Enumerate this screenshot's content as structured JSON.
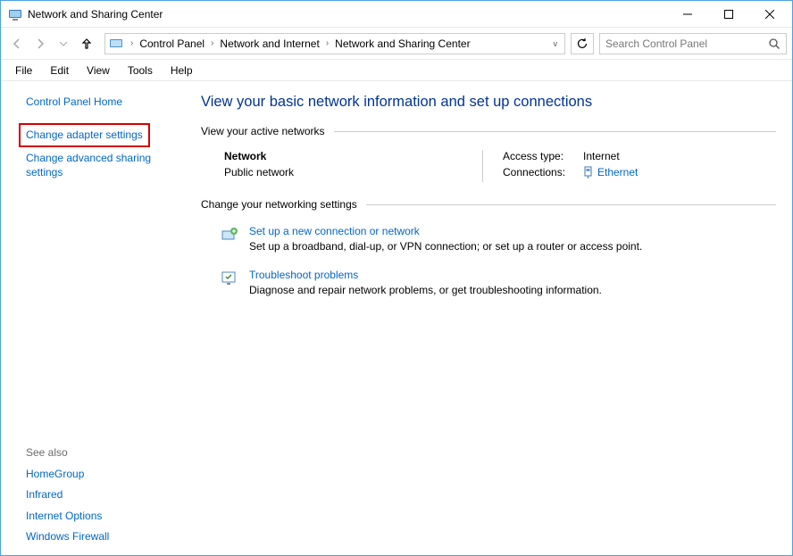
{
  "window": {
    "title": "Network and Sharing Center"
  },
  "breadcrumb": {
    "items": [
      "Control Panel",
      "Network and Internet",
      "Network and Sharing Center"
    ]
  },
  "search": {
    "placeholder": "Search Control Panel"
  },
  "menu": {
    "file": "File",
    "edit": "Edit",
    "view": "View",
    "tools": "Tools",
    "help": "Help"
  },
  "sidebar": {
    "home": "Control Panel Home",
    "adapter": "Change adapter settings",
    "advanced": "Change advanced sharing settings",
    "seealso_label": "See also",
    "seealso": [
      "HomeGroup",
      "Infrared",
      "Internet Options",
      "Windows Firewall"
    ]
  },
  "main": {
    "title": "View your basic network information and set up connections",
    "active_label": "View your active networks",
    "network": {
      "name": "Network",
      "type": "Public network",
      "access_label": "Access type:",
      "access_value": "Internet",
      "conn_label": "Connections:",
      "conn_value": "Ethernet"
    },
    "change_label": "Change your networking settings",
    "settings": [
      {
        "title": "Set up a new connection or network",
        "desc": "Set up a broadband, dial-up, or VPN connection; or set up a router or access point."
      },
      {
        "title": "Troubleshoot problems",
        "desc": "Diagnose and repair network problems, or get troubleshooting information."
      }
    ]
  }
}
